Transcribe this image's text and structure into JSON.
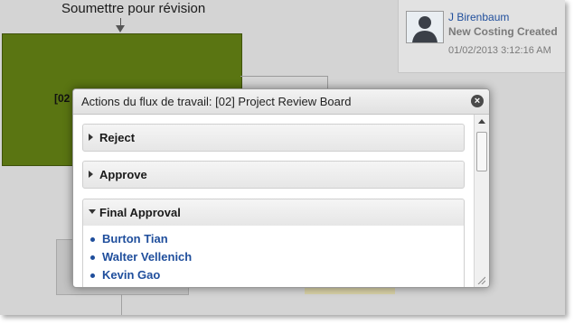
{
  "canvas": {
    "submit_label": "Soumettre pour révision",
    "green_step_label": "[02"
  },
  "history": {
    "user": "J Birenbaum",
    "action": "New Costing Created",
    "timestamp": "01/02/2013 3:12:16 AM"
  },
  "dialog": {
    "title": "Actions du flux de travail: [02] Project Review Board",
    "close_icon": "×",
    "sections": [
      {
        "label": "Reject",
        "expanded": false
      },
      {
        "label": "Approve",
        "expanded": false
      },
      {
        "label": "Final Approval",
        "expanded": true
      }
    ],
    "final_approvers": [
      "Burton Tian",
      "Walter Vellenich",
      "Kevin Gao"
    ]
  },
  "colors": {
    "green_step": "#5a7512",
    "link": "#1f4e9c"
  }
}
